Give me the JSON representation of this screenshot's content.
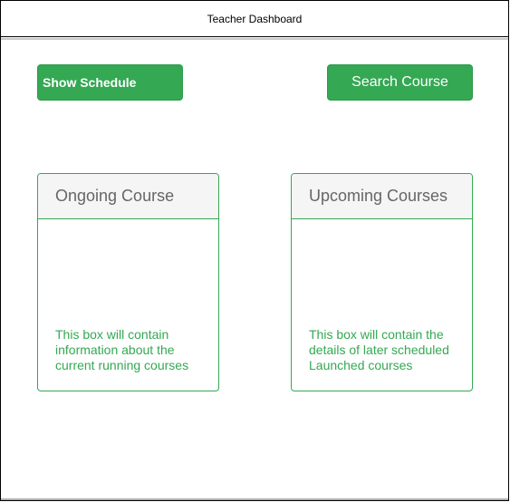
{
  "header": {
    "title": "Teacher Dashboard"
  },
  "toolbar": {
    "show_schedule_label": "Show Schedule",
    "search_course_label": "Search Course"
  },
  "cards": {
    "ongoing": {
      "title": "Ongoing Course",
      "body": "This box will contain information about the current running courses"
    },
    "upcoming": {
      "title": "Upcoming Courses",
      "body": "This box will contain the details of later scheduled Launched courses"
    }
  },
  "colors": {
    "accent": "#34a853",
    "card_header_bg": "#f5f5f5",
    "card_title_text": "#666666"
  }
}
